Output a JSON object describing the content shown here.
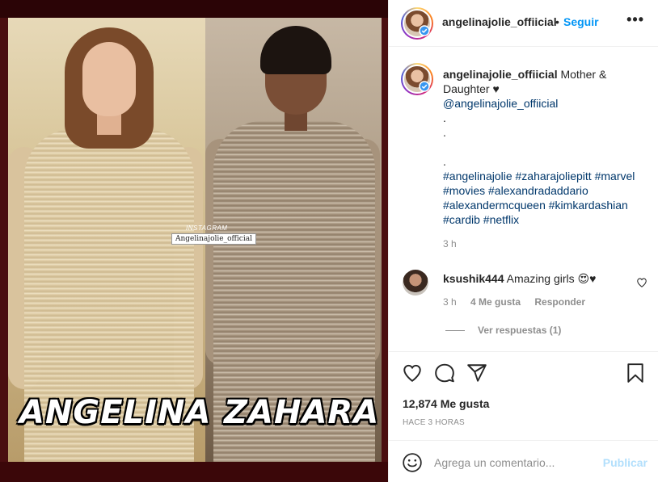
{
  "post": {
    "author": "angelinajolie_offiicial",
    "follow_separator": "•",
    "follow_label": "Seguir",
    "more_label": "•••"
  },
  "media": {
    "watermark_top": "INSTAGRAM",
    "watermark_handle": "Angelinajolie_official",
    "left_caption": "ANGELINA",
    "right_caption": "ZAHARA"
  },
  "caption": {
    "author": "angelinajolie_offiicial",
    "text": "Mother & Daughter ♥",
    "mention": "@angelinajolie_offiicial",
    "dot_lines": [
      ".",
      ".",
      "",
      "."
    ],
    "hashtags_line1": "#angelinajolie #zaharajoliepitt #marvel",
    "hashtags_line2": "#movies #alexandradaddario",
    "hashtags_line3": "#alexandermcqueen #kimkardashian",
    "hashtags_line4": "#cardib #netflix",
    "time": "3 h"
  },
  "comment": {
    "author": "ksushik444",
    "text": "Amazing girls 😍♥",
    "time": "3 h",
    "likes": "4 Me gusta",
    "reply": "Responder",
    "view_replies": "Ver respuestas (1)"
  },
  "stats": {
    "likes": "12,874 Me gusta",
    "posted": "HACE 3 HORAS"
  },
  "composer": {
    "placeholder": "Agrega un comentario...",
    "publish": "Publicar"
  },
  "icons": {
    "like": "heart-icon",
    "comment": "comment-icon",
    "share": "paper-plane-icon",
    "save": "bookmark-icon",
    "emoji": "smiley-icon",
    "more": "ellipsis-icon",
    "verified": "verified-badge-icon"
  },
  "colors": {
    "link": "#00376b",
    "follow": "#0095f6",
    "publish_disabled": "#b2dffc",
    "meta": "#8e8e8e"
  }
}
